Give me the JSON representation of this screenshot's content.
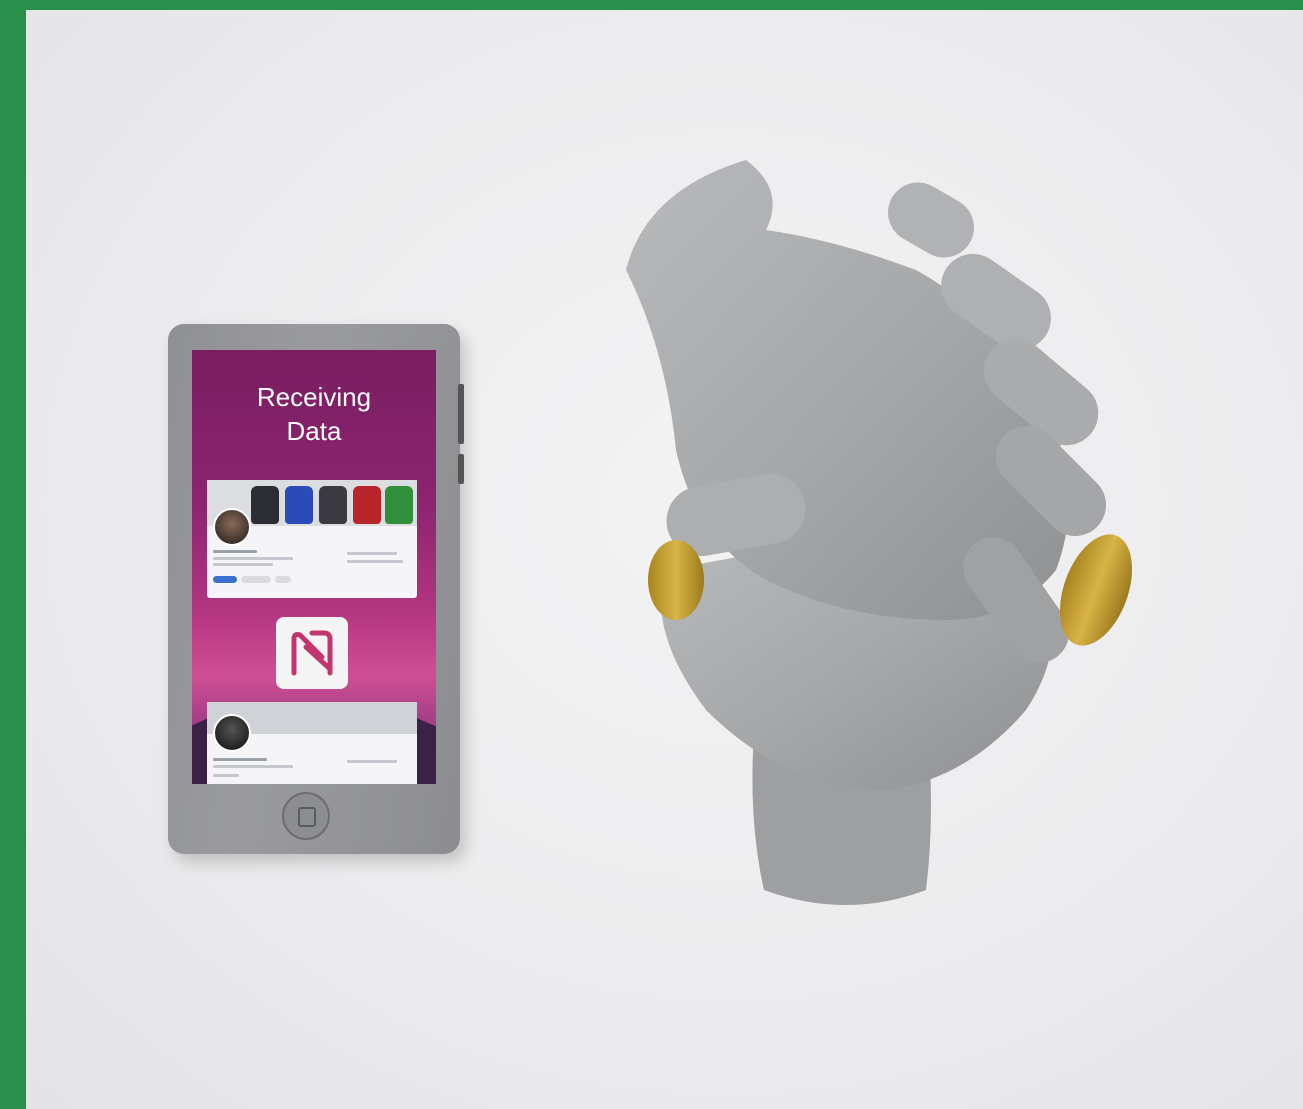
{
  "phone": {
    "screen_title": "Receiving\nData"
  },
  "colors": {
    "background_frame": "#2a8f4c",
    "sculpture_gray": "#a9abad",
    "ring_gold": "#c9a335",
    "screen_purple": "#8b2470"
  },
  "icons": {
    "nfc": "nfc-icon",
    "home_button": "home-button-icon"
  }
}
